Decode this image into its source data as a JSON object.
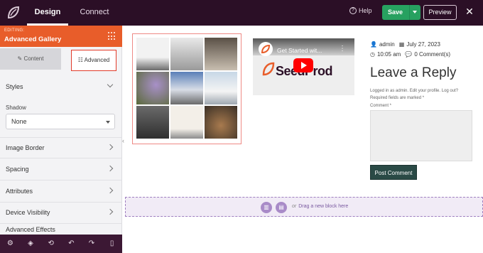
{
  "topbar": {
    "tabs": [
      "Design",
      "Connect"
    ],
    "help_label": "Help",
    "save_label": "Save",
    "preview_label": "Preview",
    "close_icon": "close-icon",
    "bg_color": "#2b0f26",
    "save_color": "#27a160"
  },
  "sidebar": {
    "editing_small": "EDITING:",
    "editing_title": "Advanced Gallery",
    "tabs": [
      "Content",
      "Advanced"
    ],
    "styles_label": "Styles",
    "shadow_label": "Shadow",
    "shadow_value": "None",
    "sections": [
      "Image Border",
      "Spacing",
      "Attributes",
      "Device Visibility",
      "Advanced Effects"
    ],
    "accent_color": "#e85d2a"
  },
  "bottom_toolbar": {
    "icons": [
      "settings-icon",
      "layers-icon",
      "history-icon",
      "undo-icon",
      "redo-icon",
      "mobile-preview-icon"
    ]
  },
  "canvas": {
    "gallery_tile_count": 9,
    "video": {
      "title": "Get Started wit...",
      "brand_text": "SeedProd"
    },
    "post_meta": {
      "author": "admin",
      "date": "July 27, 2023",
      "time": "10:05 am",
      "comments": "0 Comment(s)"
    },
    "reply_title": "Leave a Reply",
    "logged_in_text": "Logged in as admin. Edit your profile. Log out?",
    "required_text": "Required fields are marked *",
    "comment_label": "Comment *",
    "post_comment_label": "Post Comment",
    "dropzone": {
      "or_text": "or",
      "drag_text": "Drag a new block here"
    }
  }
}
